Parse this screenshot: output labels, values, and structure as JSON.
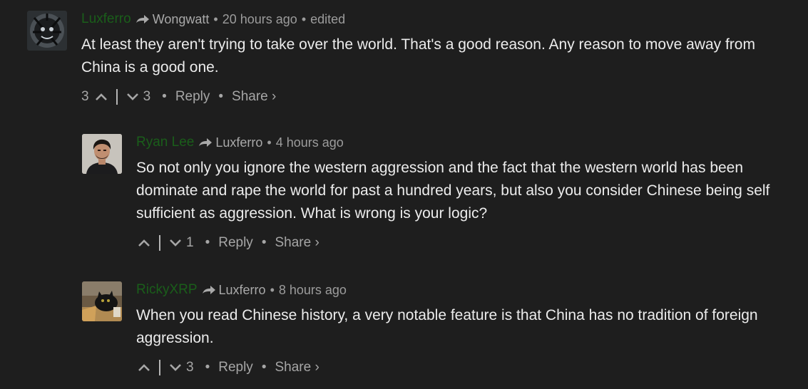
{
  "comments": [
    {
      "author": "Luxferro",
      "reply_to": "Wongwatt",
      "time": "20 hours ago",
      "edited": "edited",
      "text": "At least they aren't trying to take over the world. That's a good reason. Any reason to move away from China is a good one.",
      "upvotes": "3",
      "downvotes": "3",
      "reply_label": "Reply",
      "share_label": "Share ›",
      "avatar_icon": "dark-creature-avatar"
    },
    {
      "author": "Ryan Lee",
      "reply_to": "Luxferro",
      "time": "4 hours ago",
      "text": "So not only you ignore the western aggression and the fact that the western world has been dominate and rape the world for past a hundred years, but also you consider Chinese being self sufficient as aggression. What is wrong is your logic?",
      "upvotes": "",
      "downvotes": "1",
      "reply_label": "Reply",
      "share_label": "Share ›",
      "avatar_icon": "man-photo-avatar"
    },
    {
      "author": "RickyXRP",
      "reply_to": "Luxferro",
      "time": "8 hours ago",
      "text": "When you read Chinese history, a very notable feature is that China has no tradition of foreign aggression.",
      "upvotes": "",
      "downvotes": "3",
      "reply_label": "Reply",
      "share_label": "Share ›",
      "avatar_icon": "cat-photo-avatar"
    }
  ],
  "separator": "•",
  "colors": {
    "background": "#1e1e1e",
    "author": "#1a5e1a",
    "muted": "#9c9c9c",
    "text": "#ececec"
  }
}
